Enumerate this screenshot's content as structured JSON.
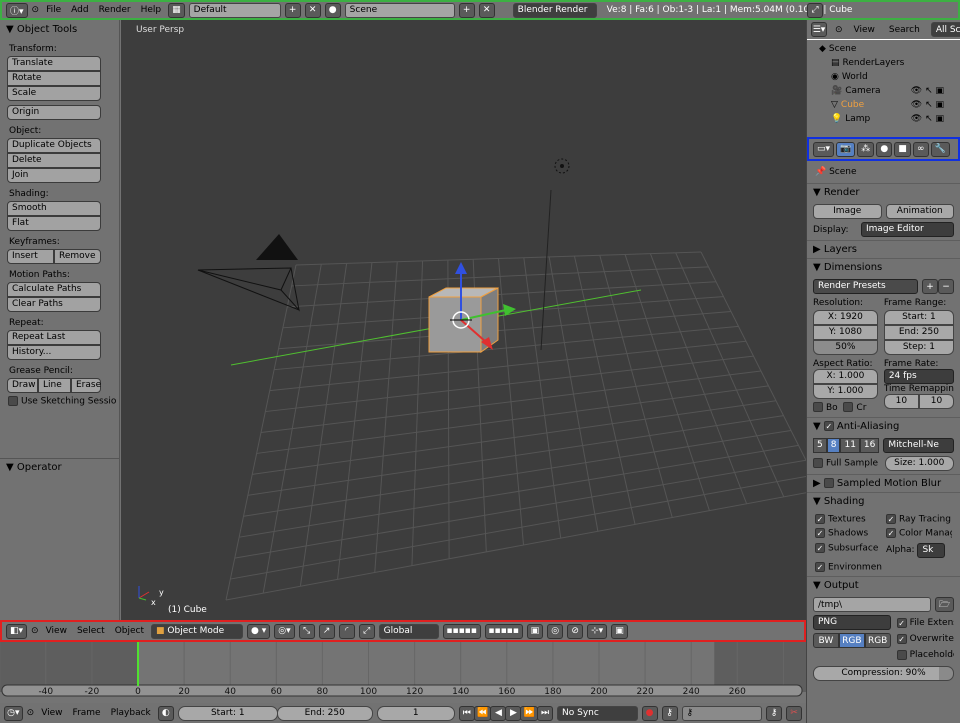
{
  "topbar": {
    "menus": [
      "File",
      "Add",
      "Render",
      "Help"
    ],
    "layout": "Default",
    "scene": "Scene",
    "engine": "Blender Render",
    "stats": "Ve:8 | Fa:6 | Ob:1-3 | La:1 | Mem:5.04M (0.10M) | Cube"
  },
  "tools": {
    "title": "Object Tools",
    "sections": [
      {
        "label": "Transform:",
        "buttons": [
          "Translate",
          "Rotate",
          "Scale"
        ]
      },
      {
        "label": "",
        "buttons": [
          "Origin"
        ]
      },
      {
        "label": "Object:",
        "buttons": [
          "Duplicate Objects",
          "Delete",
          "Join"
        ]
      },
      {
        "label": "Shading:",
        "buttons": [
          "Smooth",
          "Flat"
        ]
      }
    ],
    "keyframes": {
      "label": "Keyframes:",
      "buttons": [
        "Insert",
        "Remove"
      ]
    },
    "sections2": [
      {
        "label": "Motion Paths:",
        "buttons": [
          "Calculate Paths",
          "Clear Paths"
        ]
      },
      {
        "label": "Repeat:",
        "buttons": [
          "Repeat Last",
          "History..."
        ]
      }
    ],
    "grease": {
      "label": "Grease Pencil:",
      "buttons": [
        "Draw",
        "Line",
        "Erase"
      ],
      "sketch": "Use Sketching Sessio"
    },
    "operator": "Operator"
  },
  "viewport": {
    "label": "User Persp",
    "object": "(1) Cube",
    "axis_x": "x",
    "axis_y": "y"
  },
  "header3d": {
    "menus": [
      "View",
      "Select",
      "Object"
    ],
    "mode": "Object Mode",
    "orientation": "Global"
  },
  "timeline": {
    "ticks": [
      "-40",
      "-20",
      "0",
      "20",
      "40",
      "60",
      "80",
      "100",
      "120",
      "140",
      "160",
      "180",
      "200",
      "220",
      "240",
      "260"
    ],
    "menus": [
      "View",
      "Frame",
      "Playback"
    ],
    "start": "Start: 1",
    "end": "End: 250",
    "current": "1",
    "sync": "No Sync"
  },
  "outliner": {
    "menus": [
      "View",
      "Search"
    ],
    "filter": "All Scen",
    "items": [
      "Scene",
      "RenderLayers",
      "World",
      "Camera",
      "Cube",
      "Lamp"
    ]
  },
  "props": {
    "context": "Scene",
    "render": {
      "title": "Render",
      "image": "Image",
      "animation": "Animation",
      "display_label": "Display:",
      "display": "Image Editor"
    },
    "layers": "Layers",
    "dimensions": {
      "title": "Dimensions",
      "presets": "Render Presets",
      "res_label": "Resolution:",
      "x": "X: 1920",
      "y": "Y: 1080",
      "pct": "50%",
      "fr_label": "Frame Range:",
      "start": "Start: 1",
      "end": "End: 250",
      "step": "Step: 1",
      "ar_label": "Aspect Ratio:",
      "ax": "X: 1.000",
      "ay": "Y: 1.000",
      "rate_label": "Frame Rate:",
      "rate": "24 fps",
      "remap_label": "Time Remappin",
      "old": "10",
      "new": "10",
      "bo": "Bo",
      "cr": "Cr"
    },
    "aa": {
      "title": "Anti-Aliasing",
      "samples": [
        "5",
        "8",
        "11",
        "16"
      ],
      "filter": "Mitchell-Ne",
      "full": "Full Sample",
      "size": "Size: 1.000"
    },
    "blur": "Sampled Motion Blur",
    "shading": {
      "title": "Shading",
      "textures": "Textures",
      "shadows": "Shadows",
      "subsurface": "Subsurface",
      "environment": "Environmen",
      "ray": "Ray Tracing",
      "color": "Color Manag",
      "alpha_label": "Alpha:",
      "alpha": "Sk"
    },
    "output": {
      "title": "Output",
      "path": "/tmp\\",
      "format": "PNG",
      "bw": "BW",
      "rgb": "RGB",
      "rgba": "RGB",
      "ext": "File Extensi",
      "overwrite": "Overwrite",
      "placeholder": "Placeholder",
      "compression": "Compression: 90%"
    }
  },
  "colors": {
    "top_border": "#3cb043",
    "header_border": "#e02020",
    "props_header_border": "#1030e0",
    "viewport_bg": "#3d3d3d",
    "x_axis": "#50c030",
    "selection": "#f0a040"
  }
}
